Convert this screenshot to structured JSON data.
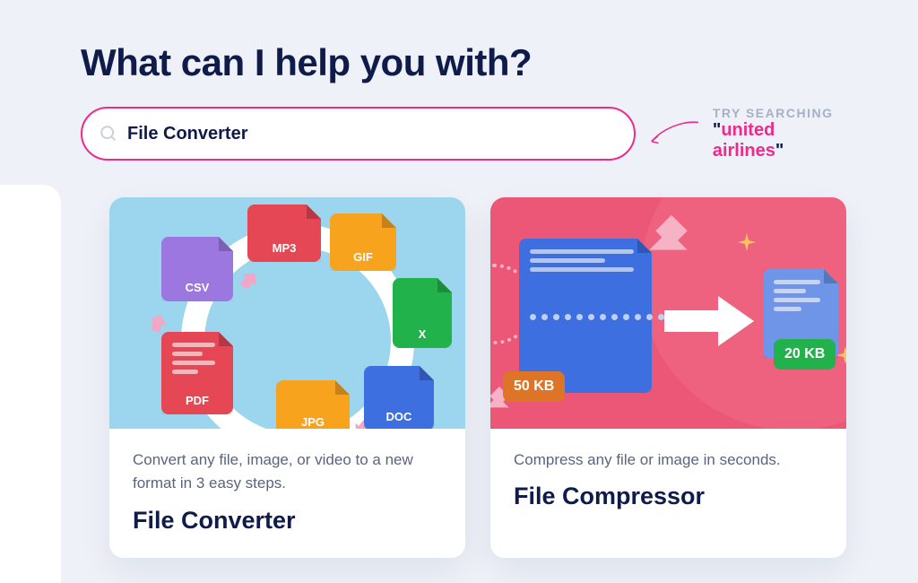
{
  "heading": "What can I help you with?",
  "search": {
    "value": "File Converter"
  },
  "hint": {
    "label": "TRY SEARCHING",
    "quoteL": "\"",
    "query": "united airlines",
    "quoteR": "\""
  },
  "cards": [
    {
      "desc": "Convert any file, image, or video to a new format in 3 easy steps.",
      "title": "File Converter",
      "badges": {
        "csv": "CSV",
        "mp3": "MP3",
        "gif": "GIF",
        "xls": "X",
        "doc": "DOC",
        "jpg": "JPG",
        "pdf": "PDF"
      }
    },
    {
      "desc": "Compress any file or image in seconds.",
      "title": "File Compressor",
      "badges": {
        "before": "50 KB",
        "after": "20 KB"
      }
    }
  ]
}
